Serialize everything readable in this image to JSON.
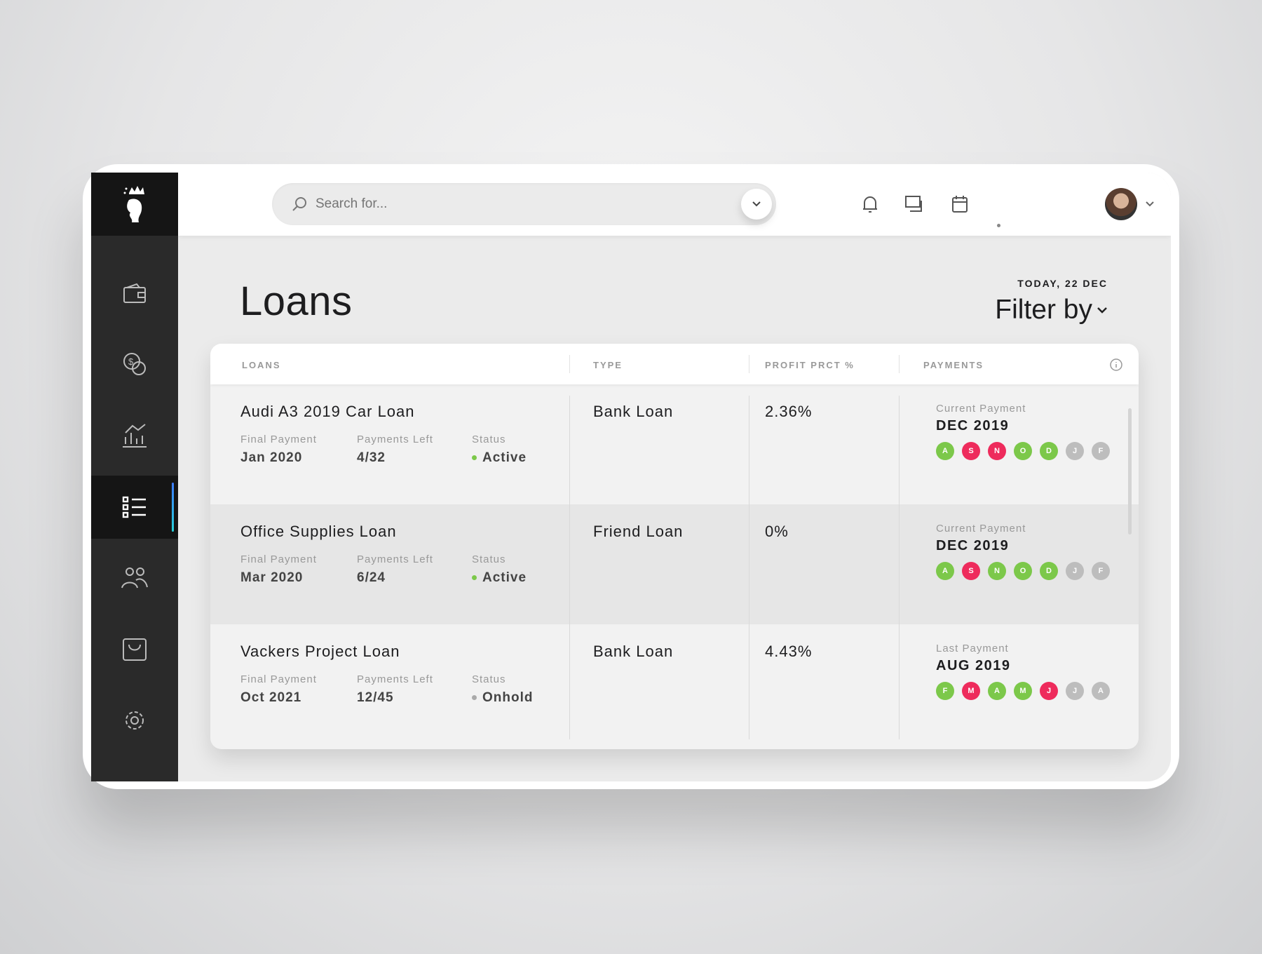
{
  "search": {
    "placeholder": "Search for..."
  },
  "header": {
    "title": "Loans",
    "today": "TODAY, 22 DEC",
    "filter_label": "Filter by"
  },
  "colors": {
    "paid": "#7cc84a",
    "missed": "#ee2b5c",
    "pending": "#bdbdbd",
    "accent": "#3d7bff"
  },
  "sidebar": {
    "items": [
      {
        "icon": "wallet-icon"
      },
      {
        "icon": "coins-icon"
      },
      {
        "icon": "chart-icon"
      },
      {
        "icon": "list-icon",
        "active": true
      },
      {
        "icon": "users-icon"
      },
      {
        "icon": "bag-icon"
      },
      {
        "icon": "settings-icon"
      }
    ]
  },
  "table": {
    "headers": [
      "LOANS",
      "TYPE",
      "PROFIT PRCT %",
      "PAYMENTS"
    ],
    "labels": {
      "final": "Final Payment",
      "left": "Payments Left",
      "status": "Status"
    },
    "rows": [
      {
        "name": "Audi A3 2019 Car Loan",
        "final": "Jan 2020",
        "left": "4/32",
        "status": "Active",
        "status_color": "#7cc84a",
        "type": "Bank Loan",
        "profit": "2.36%",
        "pay_label": "Current Payment",
        "pay_value": "DEC 2019",
        "months": [
          {
            "l": "A",
            "s": "paid"
          },
          {
            "l": "S",
            "s": "missed"
          },
          {
            "l": "N",
            "s": "missed"
          },
          {
            "l": "O",
            "s": "paid"
          },
          {
            "l": "D",
            "s": "paid"
          },
          {
            "l": "J",
            "s": "pending"
          },
          {
            "l": "F",
            "s": "pending"
          }
        ]
      },
      {
        "name": "Office Supplies Loan",
        "final": "Mar 2020",
        "left": "6/24",
        "status": "Active",
        "status_color": "#7cc84a",
        "type": "Friend Loan",
        "profit": "0%",
        "pay_label": "Current Payment",
        "pay_value": "DEC 2019",
        "months": [
          {
            "l": "A",
            "s": "paid"
          },
          {
            "l": "S",
            "s": "missed"
          },
          {
            "l": "N",
            "s": "paid"
          },
          {
            "l": "O",
            "s": "paid"
          },
          {
            "l": "D",
            "s": "paid"
          },
          {
            "l": "J",
            "s": "pending"
          },
          {
            "l": "F",
            "s": "pending"
          }
        ]
      },
      {
        "name": "Vackers Project Loan",
        "final": "Oct 2021",
        "left": "12/45",
        "status": "Onhold",
        "status_color": "#aaaaaa",
        "type": "Bank Loan",
        "profit": "4.43%",
        "pay_label": "Last Payment",
        "pay_value": "AUG 2019",
        "months": [
          {
            "l": "F",
            "s": "paid"
          },
          {
            "l": "M",
            "s": "missed"
          },
          {
            "l": "A",
            "s": "paid"
          },
          {
            "l": "M",
            "s": "paid"
          },
          {
            "l": "J",
            "s": "missed"
          },
          {
            "l": "J",
            "s": "pending"
          },
          {
            "l": "A",
            "s": "pending"
          }
        ]
      }
    ]
  }
}
